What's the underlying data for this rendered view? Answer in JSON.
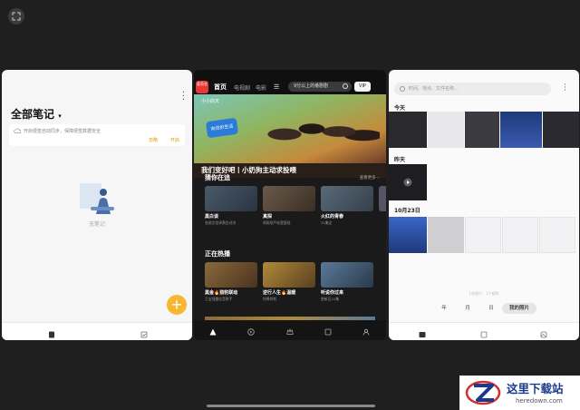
{
  "colors": {
    "accent": "#f7b731",
    "brand": "#e53935",
    "video_bg": "#1a1a1a",
    "photo_bg": "#fafafa"
  },
  "icons": {
    "expand": "fullscreen-icon",
    "cloud": "cloud-icon",
    "add": "plus-icon"
  },
  "notes": {
    "title": "全部笔记",
    "caret": "▾",
    "sync_text": "开启便签自动同步，保障便签数据安全",
    "ignore": "忽略",
    "enable": "开启",
    "empty_label": "无笔记",
    "fab": "+",
    "nav": [
      {
        "label": "笔记"
      },
      {
        "label": "待办"
      }
    ]
  },
  "video": {
    "logo": "爱奇艺",
    "tabs": [
      {
        "label": "首页"
      },
      {
        "label": "电视剧"
      },
      {
        "label": "电影"
      }
    ],
    "search_placeholder": "9分以上的番剧剧",
    "vip": "VIP",
    "show_logo": "小小的天",
    "badge": "向往的生活",
    "headline": "我们变好吧丨小奶狗主动求投喂",
    "sections": [
      {
        "title": "猜你在追",
        "more": "查看更多 ›"
      },
      {
        "title": "正在热播"
      }
    ],
    "row1": [
      {
        "title": "黑白谈",
        "sub": "张颂文张译黑白对决"
      },
      {
        "title": "真探",
        "sub": "周雨彤严屹宽搭档"
      },
      {
        "title": "火红的青春",
        "sub": "31集全"
      }
    ],
    "row2": [
      {
        "title": "黑金🔥猎豹联动",
        "sub": "王宝强雷佳音联手"
      },
      {
        "title": "逆行人生🔥温暖",
        "sub": "徐峥领衔"
      },
      {
        "title": "听说你过来",
        "sub": "更新至12集"
      }
    ],
    "nav": [
      {
        "label": "首页"
      },
      {
        "label": "随刻"
      },
      {
        "label": "会员"
      },
      {
        "label": "随心"
      },
      {
        "label": "我的"
      }
    ]
  },
  "gallery": {
    "search_placeholder": "时间、地点、文件名称...",
    "groups": [
      {
        "label": "今天"
      },
      {
        "label": "昨天"
      },
      {
        "label": "10月23日"
      }
    ],
    "empty_note": "1张照片，1个视频",
    "segments": [
      {
        "label": "年"
      },
      {
        "label": "月"
      },
      {
        "label": "日"
      },
      {
        "label": "我的照片"
      }
    ],
    "nav": [
      {
        "label": "照片"
      },
      {
        "label": "发现"
      },
      {
        "label": "相册"
      }
    ]
  },
  "watermark": {
    "cn": "这里下载站",
    "en": "heredown.com"
  }
}
